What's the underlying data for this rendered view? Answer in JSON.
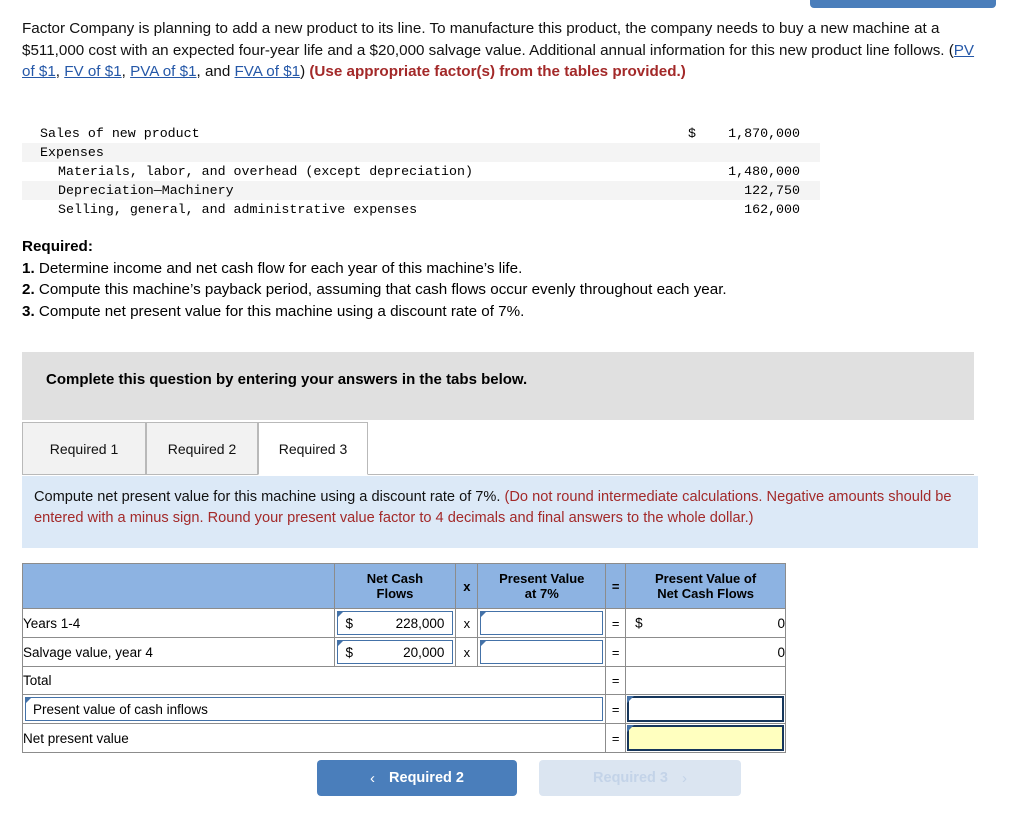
{
  "top_button": {
    "label": ""
  },
  "intro": {
    "part1": "Factor Company is planning to add a new product to its line. To manufacture this product, the company needs to buy a new machine at a $511,000 cost with an expected four-year life and a $20,000 salvage value. Additional annual information for this new product line follows. (",
    "link1": "PV of $1",
    "sep1": ", ",
    "link2": "FV of $1",
    "sep2": ", ",
    "link3": "PVA of $1",
    "sep3": ", and ",
    "link4": "FVA of $1",
    "part2": ") ",
    "bold_red": "(Use appropriate factor(s) from the tables provided.)"
  },
  "financials": {
    "rows": [
      {
        "label": "Sales of new product",
        "indent": 0,
        "dollar": "$",
        "amount": "1,870,000",
        "shaded": false
      },
      {
        "label": "Expenses",
        "indent": 0,
        "dollar": "",
        "amount": "",
        "shaded": true
      },
      {
        "label": "Materials, labor, and overhead (except depreciation)",
        "indent": 1,
        "dollar": "",
        "amount": "1,480,000",
        "shaded": false
      },
      {
        "label": "Depreciation—Machinery",
        "indent": 1,
        "dollar": "",
        "amount": "122,750",
        "shaded": true
      },
      {
        "label": "Selling, general, and administrative expenses",
        "indent": 1,
        "dollar": "",
        "amount": "162,000",
        "shaded": false
      }
    ]
  },
  "required": {
    "heading": "Required:",
    "items": [
      {
        "n": "1.",
        "text": " Determine income and net cash flow for each year of this machine’s life."
      },
      {
        "n": "2.",
        "text": " Compute this machine’s payback period, assuming that cash flows occur evenly throughout each year."
      },
      {
        "n": "3.",
        "text": " Compute net present value for this machine using a discount rate of 7%."
      }
    ]
  },
  "complete_bar": {
    "text": "Complete this question by entering your answers in the tabs below."
  },
  "tabs": [
    {
      "label": "Required 1",
      "active": false
    },
    {
      "label": "Required 2",
      "active": false
    },
    {
      "label": "Required 3",
      "active": true
    }
  ],
  "instruction": {
    "black": "Compute net present value for this machine using a discount rate of 7%. ",
    "red": "(Do not round intermediate calculations. Negative amounts should be entered with a minus sign. Round your present value factor to 4 decimals and final answers to the whole dollar.)"
  },
  "answer_table": {
    "headers": {
      "desc": "",
      "net_cash_flows": "Net Cash Flows",
      "times": "x",
      "present_value": "Present Value at 7%",
      "equals": "=",
      "pv_net_cash_flows": "Present Value of Net Cash Flows"
    },
    "header_lines": {
      "ncf_1": "Net Cash",
      "ncf_2": "Flows",
      "pv_1": "Present Value",
      "pv_2": "at 7%",
      "res_1": "Present Value of",
      "res_2": "Net Cash Flows"
    },
    "rows": [
      {
        "label": "Years 1-4",
        "ncf_dollar": "$",
        "ncf_value": "228,000",
        "times": "x",
        "pv_value": "",
        "equals": "=",
        "res_dollar": "$",
        "res_value": "0"
      },
      {
        "label": "Salvage value, year 4",
        "ncf_dollar": "$",
        "ncf_value": "20,000",
        "times": "x",
        "pv_value": "",
        "equals": "=",
        "res_dollar": "",
        "res_value": "0"
      }
    ],
    "total_row": {
      "label": "Total",
      "equals": "=",
      "value": ""
    },
    "pv_inflows_row": {
      "label": "Present value of cash inflows",
      "equals": "=",
      "value": ""
    },
    "npv_row": {
      "label": "Net present value",
      "equals": "=",
      "value": ""
    }
  },
  "nav": {
    "prev_chevron": "‹",
    "prev_label": "Required 2",
    "next_label": "Required 3",
    "next_chevron": "›"
  },
  "colors": {
    "header_blue": "#8db3e2",
    "panel_blue": "#dce9f7",
    "gray_bar": "#e0e0e0",
    "accent_blue": "#4a7ebb",
    "red": "#a32929",
    "link_blue": "#2558a8",
    "input_border": "#4472a8",
    "highlight_yellow": "#ffffbf"
  }
}
